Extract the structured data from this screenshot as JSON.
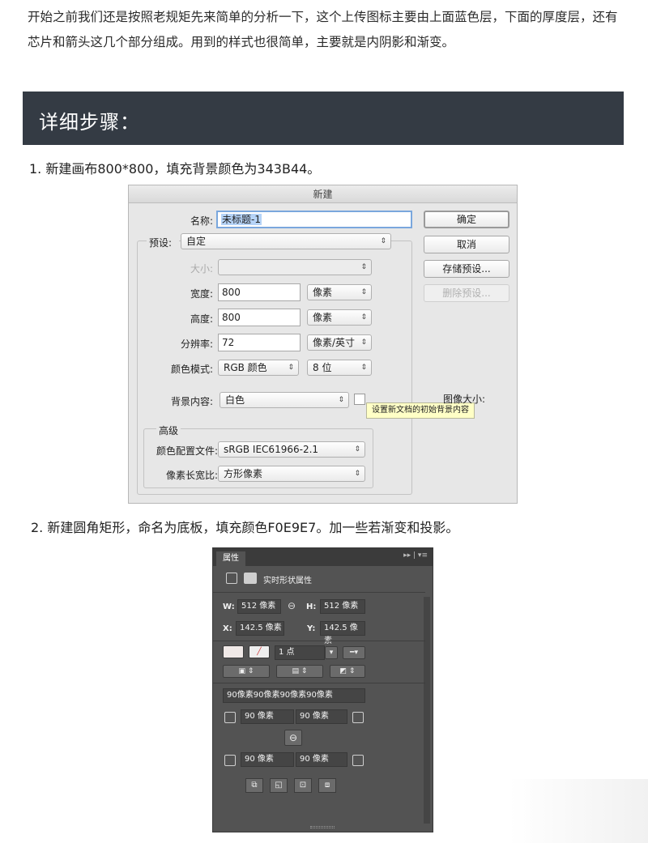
{
  "article": {
    "intro": "开始之前我们还是按照老规矩先来简单的分析一下，这个上传图标主要由上面蓝色层，下面的厚度层，还有芯片和箭头这几个部分组成。用到的样式也很简单，主要就是内阴影和渐变。",
    "section_title": "详细步骤：",
    "step1": "1. 新建画布800*800，填充背景颜色为343B44。",
    "step2": "2. 新建圆角矩形，命名为底板，填充颜色F0E9E7。加一些若渐变和投影。",
    "colors": {
      "section_bar": "#343B44"
    }
  },
  "new_dialog": {
    "title": "新建",
    "name_label": "名称:",
    "name_value": "未标题-1",
    "preset_label": "预设:",
    "preset_value": "自定",
    "size_label": "大小:",
    "width_label": "宽度:",
    "width_value": "800",
    "width_unit": "像素",
    "height_label": "高度:",
    "height_value": "800",
    "height_unit": "像素",
    "resolution_label": "分辨率:",
    "resolution_value": "72",
    "resolution_unit": "像素/英寸",
    "color_mode_label": "颜色模式:",
    "color_mode_value": "RGB 颜色",
    "bit_depth_value": "8 位",
    "background_label": "背景内容:",
    "background_value": "白色",
    "advanced_label": "高级",
    "color_profile_label": "颜色配置文件:",
    "color_profile_value": "sRGB IEC61966-2.1",
    "pixel_aspect_label": "像素长宽比:",
    "pixel_aspect_value": "方形像素",
    "ok_button": "确定",
    "cancel_button": "取消",
    "save_preset_button": "存储预设...",
    "delete_preset_button": "删除预设...",
    "image_size_label": "图像大小:",
    "tooltip": "设置新文档的初始背景内容"
  },
  "properties_panel": {
    "tab_label": "属性",
    "menu_icons": "▸▸ | ▾≡",
    "title": "实时形状属性",
    "w_label": "W:",
    "w_value": "512 像素",
    "h_label": "H:",
    "h_value": "512 像素",
    "x_label": "X:",
    "x_value": "142.5 像素",
    "y_label": "Y:",
    "y_value": "142.5 像素",
    "stroke_width": "1 点",
    "corner_summary": "90像素90像素90像素90像素",
    "corner_tl": "90 像素",
    "corner_tr": "90 像素",
    "corner_bl": "90 像素",
    "corner_br": "90 像素"
  }
}
